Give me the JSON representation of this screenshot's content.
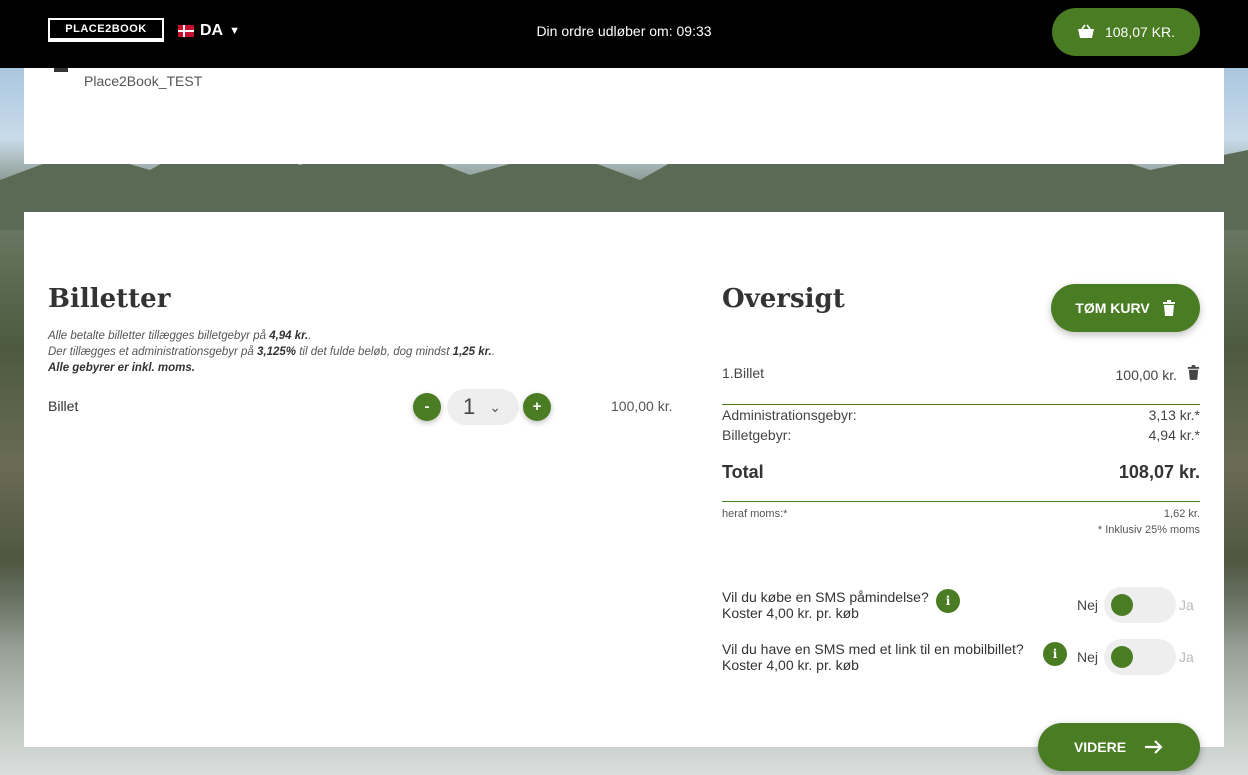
{
  "header": {
    "logo": "PLACE2BOOK",
    "language": "DA",
    "timer_label": "Din ordre udløber om:",
    "timer_value": "09:33",
    "cart_total": "108,07 KR."
  },
  "venue": {
    "name": "Place2Book_TEST"
  },
  "tickets": {
    "title": "Billetter",
    "note1_pre": "Alle betalte billetter tillægges billetgebyr på ",
    "note1_val": "4,94 kr.",
    "note1_post": ".",
    "note2_pre": "Der tillægges et administrationsgebyr på ",
    "note2_pct": "3,125%",
    "note2_mid": " til det fulde beløb, dog mindst ",
    "note2_val": "1,25 kr.",
    "note2_post": ".",
    "note3": "Alle gebyrer er inkl. moms.",
    "item_label": "Billet",
    "minus": "-",
    "plus": "+",
    "quantity": "1",
    "item_price": "100,00 kr."
  },
  "summary": {
    "title": "Oversigt",
    "clear_label": "TØM KURV",
    "line1_label": "1.Billet",
    "line1_price": "100,00 kr.",
    "admin_label": "Administrationsgebyr:",
    "admin_value": "3,13 kr.*",
    "fee_label": "Billetgebyr:",
    "fee_value": "4,94 kr.*",
    "total_label": "Total",
    "total_value": "108,07 kr.",
    "vat_label": "heraf moms:*",
    "vat_value": "1,62 kr.",
    "vat_note": "* Inklusiv 25% moms"
  },
  "sms": {
    "q1": "Vil du købe en SMS påmindelse?",
    "q1_cost": "Koster 4,00 kr. pr. køb",
    "q2": "Vil du have en SMS med et link til en mobilbillet?",
    "q2_cost": "Koster 4,00 kr. pr. køb",
    "no": "Nej",
    "yes": "Ja",
    "info_glyph": "i"
  },
  "footer": {
    "next_label": "VIDERE"
  },
  "colors": {
    "accent": "#4a7c23",
    "topbar": "#000000"
  }
}
